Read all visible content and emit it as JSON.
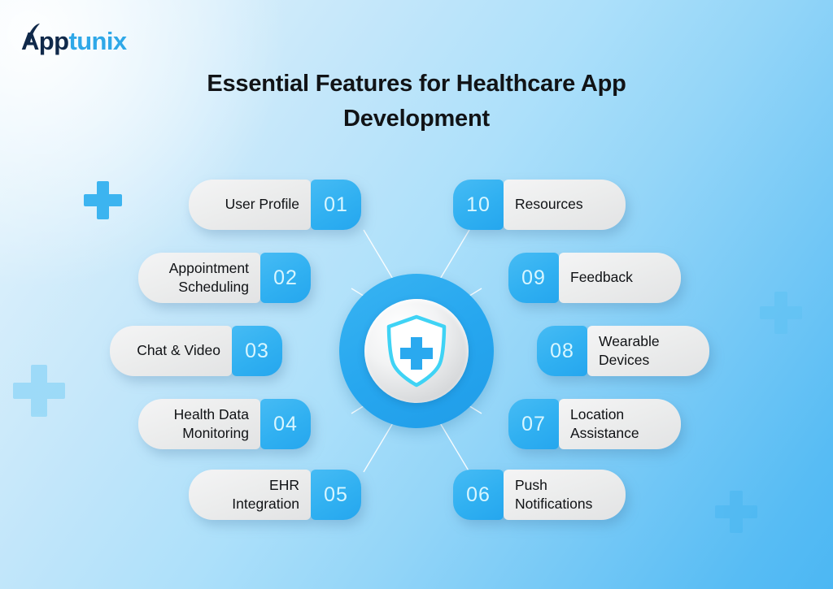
{
  "brand": {
    "name_dark": "App",
    "name_blue": "tunix",
    "logo_icon": "apptunix-arc-logo"
  },
  "title": "Essential Features for Healthcare App Development",
  "hub": {
    "icon": "medical-shield-icon",
    "ring_color": "#2aa9ef",
    "inner_color": "#e6e8ea"
  },
  "colors": {
    "accent": "#30b0f1",
    "badge_text": "#d8f6ff",
    "card_bg": "#ececed",
    "text": "#101215",
    "background_from": "#eaf6fd",
    "background_to": "#4cb7f3"
  },
  "features": [
    {
      "number": "01",
      "label": "User Profile",
      "side": "left"
    },
    {
      "number": "02",
      "label": "Appointment\nScheduling",
      "side": "left"
    },
    {
      "number": "03",
      "label": "Chat & Video",
      "side": "left"
    },
    {
      "number": "04",
      "label": "Health Data\nMonitoring",
      "side": "left"
    },
    {
      "number": "05",
      "label": "EHR\nIntegration",
      "side": "left"
    },
    {
      "number": "06",
      "label": "Push\nNotifications",
      "side": "right"
    },
    {
      "number": "07",
      "label": "Location\nAssistance",
      "side": "right"
    },
    {
      "number": "08",
      "label": "Wearable\nDevices",
      "side": "right"
    },
    {
      "number": "09",
      "label": "Feedback",
      "side": "right"
    },
    {
      "number": "10",
      "label": "Resources",
      "side": "right"
    }
  ],
  "decorations": [
    {
      "name": "plus-decoration-top-left"
    },
    {
      "name": "plus-decoration-left"
    },
    {
      "name": "plus-decoration-right"
    },
    {
      "name": "plus-decoration-bottom-right"
    }
  ]
}
